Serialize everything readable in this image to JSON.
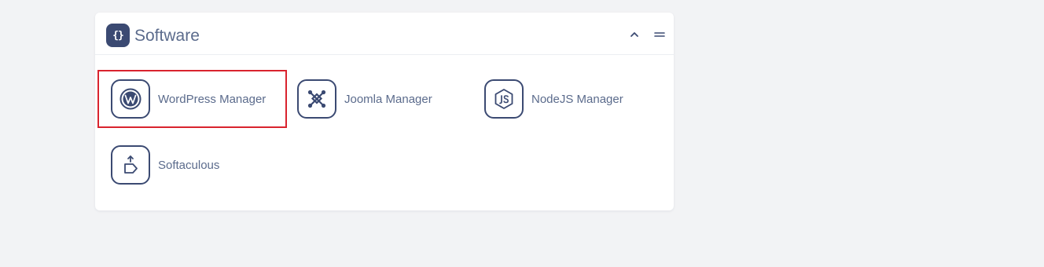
{
  "panel": {
    "title": "Software",
    "header_icon": "code-braces-icon",
    "header_icon_glyph": "{}"
  },
  "apps": [
    {
      "label": "WordPress Manager",
      "icon": "wordpress-icon"
    },
    {
      "label": "Joomla Manager",
      "icon": "joomla-icon"
    },
    {
      "label": "NodeJS Manager",
      "icon": "nodejs-icon"
    },
    {
      "label": "Softaculous",
      "icon": "softaculous-icon"
    }
  ],
  "colors": {
    "background": "#f2f3f5",
    "card": "#ffffff",
    "accent": "#3b4a72",
    "text": "#5b6b8c",
    "highlight": "#d9232e"
  }
}
